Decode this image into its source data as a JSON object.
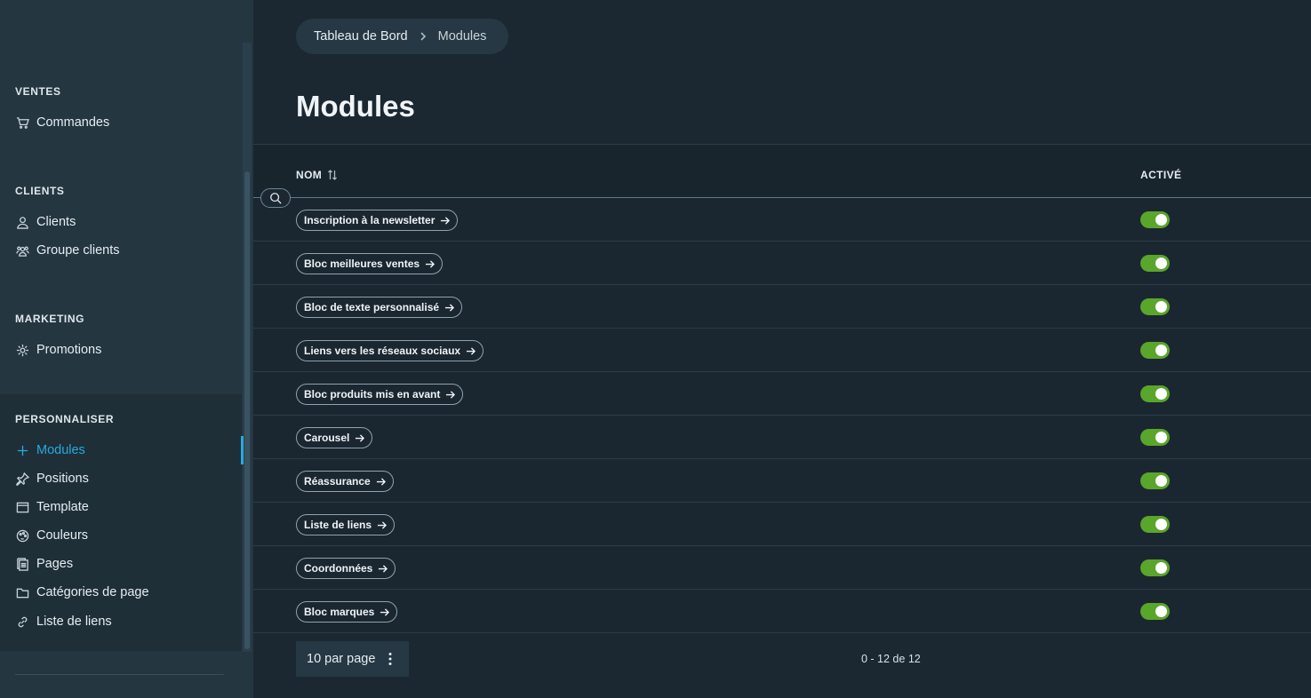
{
  "sidebar": {
    "sections": [
      {
        "title": "VENTES",
        "items": [
          {
            "label": "Commandes",
            "icon": "cart-icon"
          }
        ]
      },
      {
        "title": "CLIENTS",
        "items": [
          {
            "label": "Clients",
            "icon": "user-icon"
          },
          {
            "label": "Groupe clients",
            "icon": "users-icon"
          }
        ]
      },
      {
        "title": "MARKETING",
        "items": [
          {
            "label": "Promotions",
            "icon": "gear-icon"
          }
        ]
      },
      {
        "title": "PERSONNALISER",
        "items": [
          {
            "label": "Modules",
            "icon": "plus-icon",
            "active": true
          },
          {
            "label": "Positions",
            "icon": "pin-icon"
          },
          {
            "label": "Template",
            "icon": "window-icon"
          },
          {
            "label": "Couleurs",
            "icon": "palette-icon"
          },
          {
            "label": "Pages",
            "icon": "pages-icon"
          },
          {
            "label": "Catégories de page",
            "icon": "folder-icon"
          },
          {
            "label": "Liste de liens",
            "icon": "link-icon"
          }
        ]
      }
    ]
  },
  "breadcrumb": {
    "root": "Tableau de Bord",
    "current": "Modules"
  },
  "page": {
    "title": "Modules"
  },
  "table": {
    "columns": {
      "name": "NOM",
      "active": "ACTIVÉ"
    },
    "rows": [
      {
        "name": "Inscription à la newsletter",
        "active": true
      },
      {
        "name": "Bloc meilleures ventes",
        "active": true
      },
      {
        "name": "Bloc de texte personnalisé",
        "active": true
      },
      {
        "name": "Liens vers les réseaux sociaux",
        "active": true
      },
      {
        "name": "Bloc produits mis en avant",
        "active": true
      },
      {
        "name": "Carousel",
        "active": true
      },
      {
        "name": "Réassurance",
        "active": true
      },
      {
        "name": "Liste de liens",
        "active": true
      },
      {
        "name": "Coordonnées",
        "active": true
      },
      {
        "name": "Bloc marques",
        "active": true
      }
    ]
  },
  "pagination": {
    "per_page_label": "10 par page",
    "info": "0 - 12 de 12"
  },
  "colors": {
    "accent": "#2aa8e0",
    "toggle_on": "#5aa52b",
    "background": "#1c2831",
    "sidebar": "#243640"
  }
}
